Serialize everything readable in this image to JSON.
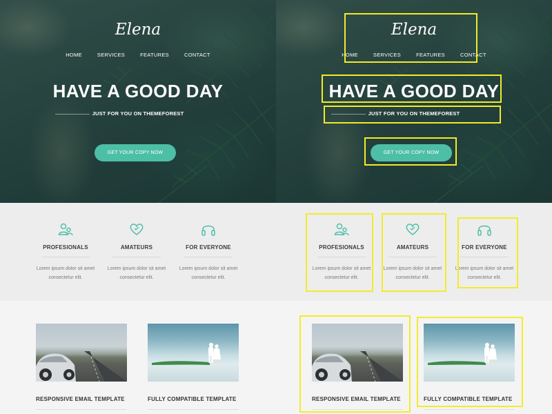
{
  "hero": {
    "logo": "Elena",
    "nav": [
      "HOME",
      "SERVICES",
      "FEATURES",
      "CONTACT"
    ],
    "title": "HAVE A GOOD DAY",
    "subtitle": "JUST FOR YOU ON THEMEFOREST",
    "cta_label": "GET YOUR COPY NOW"
  },
  "features": [
    {
      "icon": "users-icon",
      "title": "PROFESIONALS",
      "text_line1": "Lorem ipsum dolor sit amet",
      "text_line2": "consectetur elit."
    },
    {
      "icon": "heart-icon",
      "title": "AMATEURS",
      "text_line1": "Lorem ipsum dolor sit amet",
      "text_line2": "consectetur elit."
    },
    {
      "icon": "headphones-icon",
      "title": "FOR EVERYONE",
      "text_line1": "Lorem ipsum dolor sit amet",
      "text_line2": "consectetur elit."
    }
  ],
  "templates": [
    {
      "image": "vintage-car-road-image",
      "title": "RESPONSIVE EMAIL TEMPLATE"
    },
    {
      "image": "couple-on-beach-image",
      "title": "FULLY COMPATIBLE TEMPLATE"
    }
  ],
  "colors": {
    "accent": "#4dbfa6",
    "highlight": "#f2ec28",
    "hero_bg": "#2f4d47",
    "features_bg": "#ededee"
  }
}
